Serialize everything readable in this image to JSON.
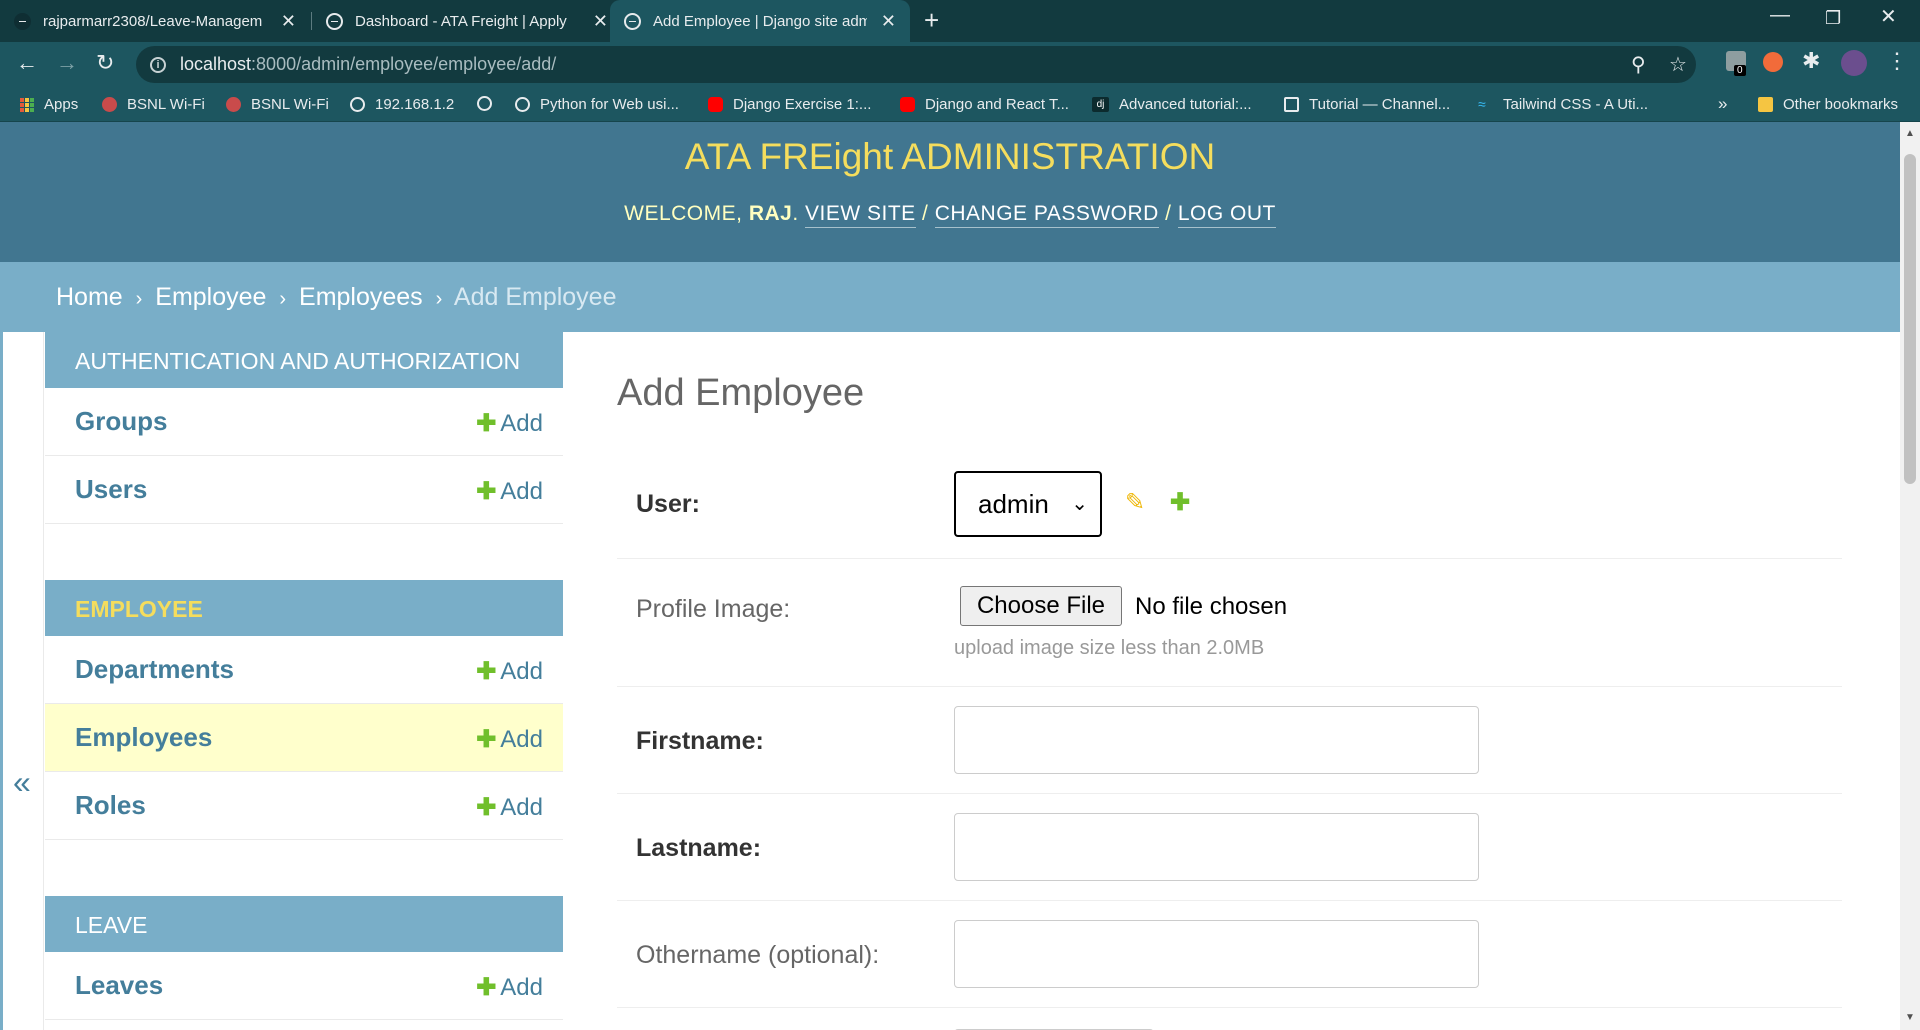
{
  "browser": {
    "tabs": [
      {
        "title": "rajparmarr2308/Leave-Managem",
        "active": false
      },
      {
        "title": "Dashboard - ATA Freight | Apply",
        "active": false
      },
      {
        "title": "Add Employee | Django site adm",
        "active": true
      }
    ],
    "url_host": "localhost",
    "url_rest": ":8000/admin/employee/employee/add/",
    "extension_badge": "0",
    "bookmarks": [
      {
        "label": "Apps",
        "icon": "apps-grid-icon"
      },
      {
        "label": "BSNL Wi-Fi",
        "icon": "bsnl-icon"
      },
      {
        "label": "BSNL Wi-Fi",
        "icon": "bsnl-icon"
      },
      {
        "label": "192.168.1.2",
        "icon": "globe-icon"
      },
      {
        "label": "",
        "icon": "globe-icon"
      },
      {
        "label": "Python for Web usi...",
        "icon": "globe-icon"
      },
      {
        "label": "Django Exercise 1:...",
        "icon": "youtube-icon"
      },
      {
        "label": "Django and React T...",
        "icon": "youtube-icon"
      },
      {
        "label": "Advanced tutorial:...",
        "icon": "django-icon"
      },
      {
        "label": "Tutorial — Channel...",
        "icon": "docs-icon"
      },
      {
        "label": "Tailwind CSS - A Uti...",
        "icon": "tailwind-icon"
      }
    ],
    "more_bookmarks": "»",
    "other_bookmarks": "Other bookmarks"
  },
  "header": {
    "site_title": "ATA FREight ADMINISTRATION",
    "welcome": "WELCOME, ",
    "username": "RAJ",
    "period": ". ",
    "view_site": "VIEW SITE",
    "change_password": "CHANGE PASSWORD",
    "log_out": "LOG OUT",
    "slash": " / "
  },
  "breadcrumbs": {
    "home": "Home",
    "app": "Employee",
    "model": "Employees",
    "current": "Add Employee",
    "separator": "›"
  },
  "sidebar": {
    "toggle": "«",
    "add_label": "Add",
    "modules": [
      {
        "caption": "AUTHENTICATION AND AUTHORIZATION",
        "models": [
          "Groups",
          "Users"
        ]
      },
      {
        "caption": "EMPLOYEE",
        "models": [
          "Departments",
          "Employees",
          "Roles"
        ]
      },
      {
        "caption": "LEAVE",
        "models": [
          "Leaves"
        ]
      }
    ]
  },
  "form": {
    "title": "Add Employee",
    "user_label": "User:",
    "user_value": "admin",
    "profile_image_label": "Profile Image:",
    "choose_file": "Choose File",
    "no_file": "No file chosen",
    "profile_help": "upload image size less than 2.0MB",
    "firstname_label": "Firstname:",
    "lastname_label": "Lastname:",
    "othername_label": "Othername (optional):",
    "firstname_value": "",
    "lastname_value": "",
    "othername_value": ""
  },
  "colors": {
    "header_bg": "#417690",
    "breadcrumb_bg": "#79aec8",
    "title_yellow": "#f5dd5d",
    "link_blue": "#447e9b",
    "add_green": "#70bf2b",
    "current_row": "#ffffcc"
  }
}
